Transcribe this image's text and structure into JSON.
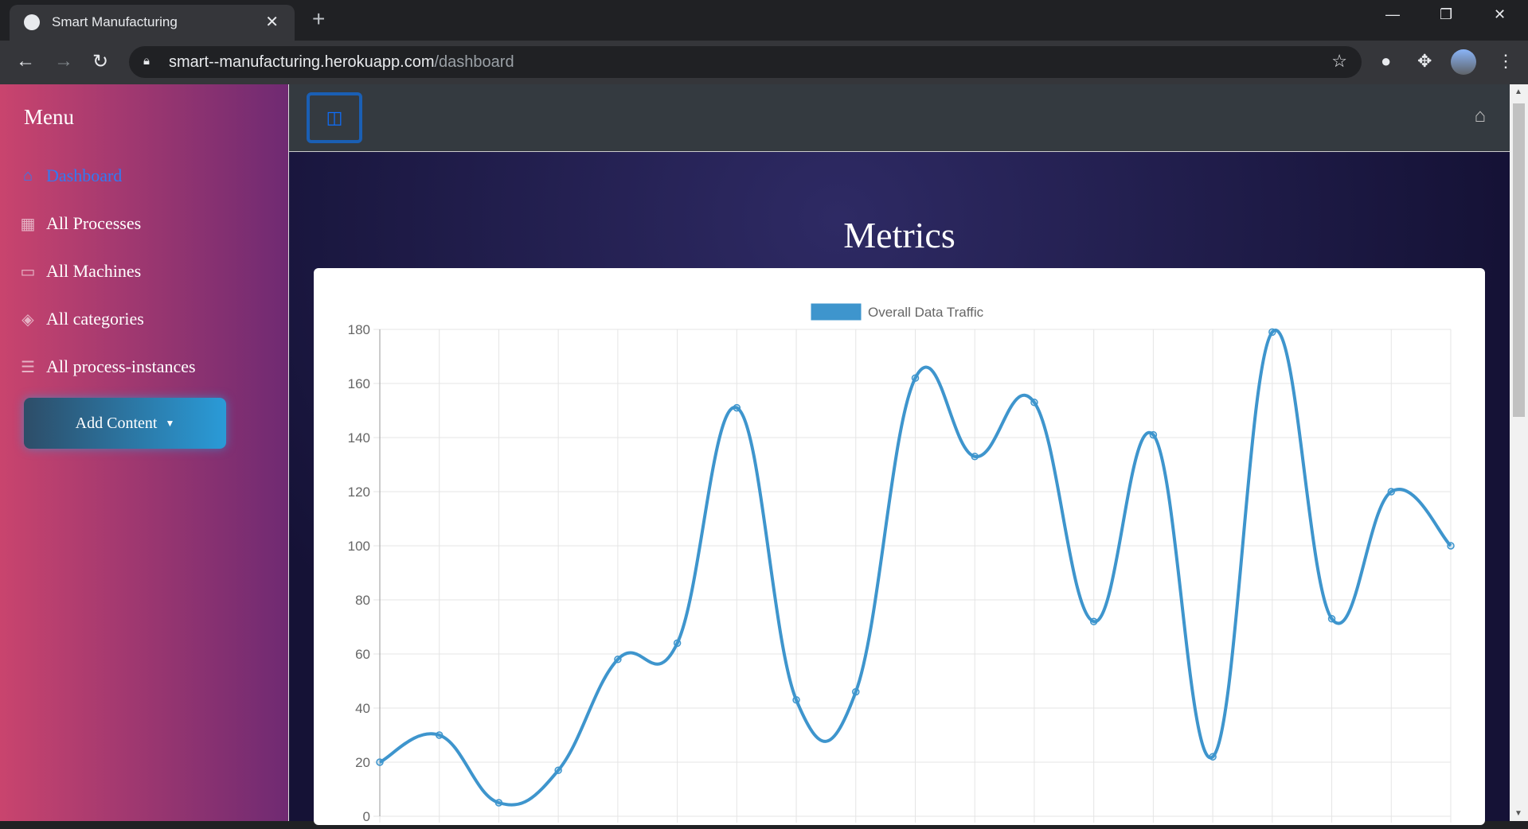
{
  "browser": {
    "tab_title": "Smart Manufacturing",
    "url_host": "smart--manufacturing.herokuapp.com",
    "url_path": "/dashboard"
  },
  "sidebar": {
    "title": "Menu",
    "items": [
      {
        "label": "Dashboard",
        "icon": "home-icon"
      },
      {
        "label": "All Processes",
        "icon": "grid-icon"
      },
      {
        "label": "All Machines",
        "icon": "hdd-icon"
      },
      {
        "label": "All categories",
        "icon": "layers-icon"
      },
      {
        "label": "All process-instances",
        "icon": "list-icon"
      }
    ],
    "add_button": "Add Content"
  },
  "main": {
    "heading": "Metrics"
  },
  "colors": {
    "accent": "#2f7bf5",
    "line": "#3e95cd"
  },
  "chart_data": {
    "type": "line",
    "title": "",
    "legend": [
      "Overall Data Traffic"
    ],
    "legend_placement": "top",
    "xlabel": "",
    "ylabel": "",
    "ylim": [
      0,
      180
    ],
    "yticks": [
      0,
      20,
      40,
      60,
      80,
      100,
      120,
      140,
      160,
      180
    ],
    "grid": true,
    "series": [
      {
        "name": "Overall Data Traffic",
        "values": [
          20,
          30,
          5,
          17,
          58,
          64,
          151,
          43,
          46,
          162,
          133,
          153,
          72,
          141,
          22,
          179,
          73,
          120,
          100
        ]
      }
    ]
  }
}
